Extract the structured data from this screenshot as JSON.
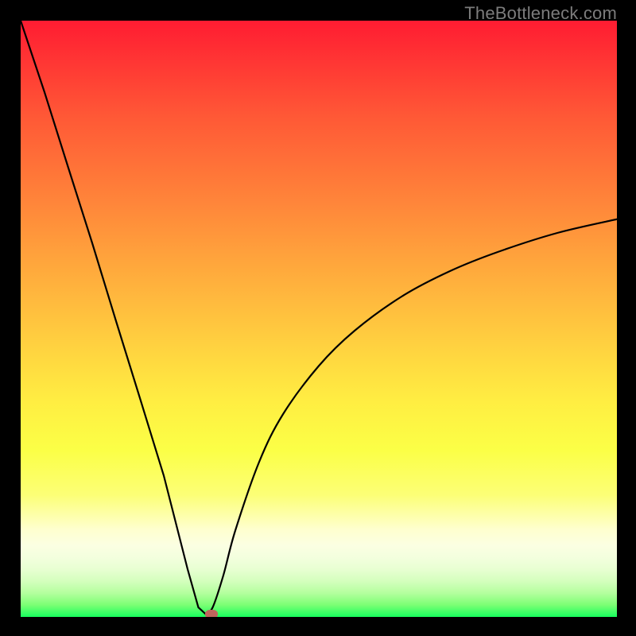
{
  "watermark": "TheBottleneck.com",
  "colors": {
    "background": "#000000",
    "curve_stroke": "#000000",
    "marker_fill": "#c0655d",
    "watermark_text": "#7c7c7c"
  },
  "chart_data": {
    "type": "line",
    "title": "",
    "xlabel": "",
    "ylabel": "",
    "xlim": [
      0,
      100
    ],
    "ylim": [
      0,
      100
    ],
    "curve_description": "Bottleneck-style V-curve: steep left descent from top-left to a sharp minimum near x≈31, then a concave rise flattening toward the right edge.",
    "minimum_x": 31,
    "x": [
      0,
      4,
      8,
      12,
      16,
      20,
      24,
      28,
      29.8,
      31,
      32.2,
      34,
      36,
      40,
      44,
      50,
      56,
      64,
      72,
      80,
      90,
      100
    ],
    "y": [
      100,
      88,
      75.3,
      62.7,
      49.6,
      36.7,
      23.7,
      8.0,
      1.6,
      0.5,
      1.6,
      7.0,
      14.5,
      26.0,
      34.0,
      42.1,
      48.0,
      53.8,
      58.0,
      61.2,
      64.4,
      66.7
    ],
    "marker": {
      "x": 32,
      "y": 0.5,
      "shape": "rounded-rect",
      "color": "#c0655d"
    },
    "background_gradient": {
      "direction": "vertical",
      "description": "Smooth multi-stop heat gradient from red at top through orange and yellow to green at bottom, with a pale yellow band near the lower 80–90% range.",
      "stops": [
        {
          "pct": 0,
          "color": "#ff1c32"
        },
        {
          "pct": 24,
          "color": "#ff7138"
        },
        {
          "pct": 48,
          "color": "#ffbd3e"
        },
        {
          "pct": 72,
          "color": "#fbff46"
        },
        {
          "pct": 86,
          "color": "#feffce"
        },
        {
          "pct": 94,
          "color": "#d4ffbd"
        },
        {
          "pct": 100,
          "color": "#17ff5d"
        }
      ]
    }
  }
}
